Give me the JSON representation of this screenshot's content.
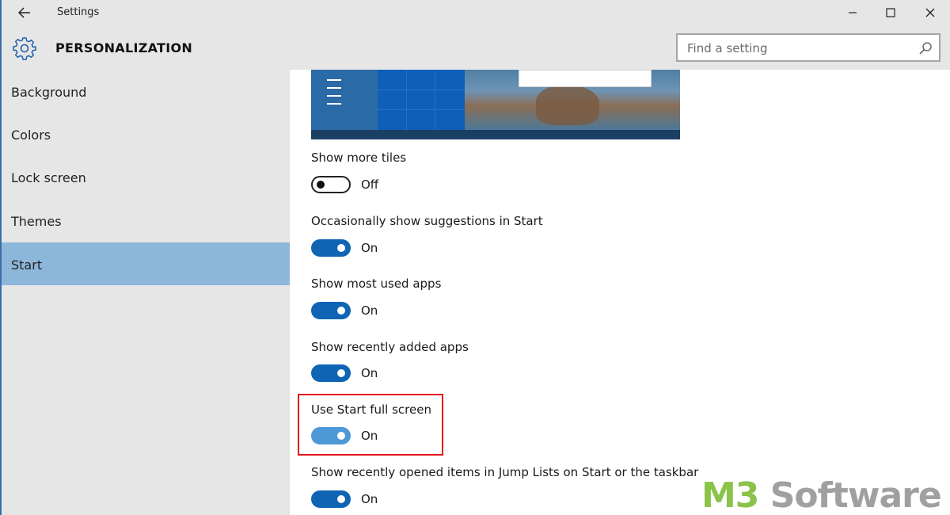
{
  "titlebar": {
    "app_title": "Settings",
    "back_icon": "back-arrow-icon",
    "minimize_icon": "minimize-icon",
    "maximize_icon": "maximize-icon",
    "close_icon": "close-icon"
  },
  "header": {
    "section_title": "PERSONALIZATION",
    "icon": "gear-icon"
  },
  "search": {
    "placeholder": "Find a setting",
    "icon": "search-icon"
  },
  "sidebar": {
    "items": [
      {
        "label": "Background",
        "selected": false
      },
      {
        "label": "Colors",
        "selected": false
      },
      {
        "label": "Lock screen",
        "selected": false
      },
      {
        "label": "Themes",
        "selected": false
      },
      {
        "label": "Start",
        "selected": true
      }
    ]
  },
  "settings": [
    {
      "label": "Show more tiles",
      "state": "Off",
      "on": false
    },
    {
      "label": "Occasionally show suggestions in Start",
      "state": "On",
      "on": true
    },
    {
      "label": "Show most used apps",
      "state": "On",
      "on": true
    },
    {
      "label": "Show recently added apps",
      "state": "On",
      "on": true
    },
    {
      "label": "Use Start full screen",
      "state": "On",
      "on": true,
      "highlighted": true
    },
    {
      "label": "Show recently opened items in Jump Lists on Start or the taskbar",
      "state": "On",
      "on": true
    }
  ],
  "watermark": {
    "part1": "M3",
    "part2": " Software"
  },
  "colors": {
    "accent": "#0f64b4",
    "selected_nav": "#8db6db",
    "highlight_box": "#e4141b",
    "watermark_green": "#8bc34a"
  }
}
